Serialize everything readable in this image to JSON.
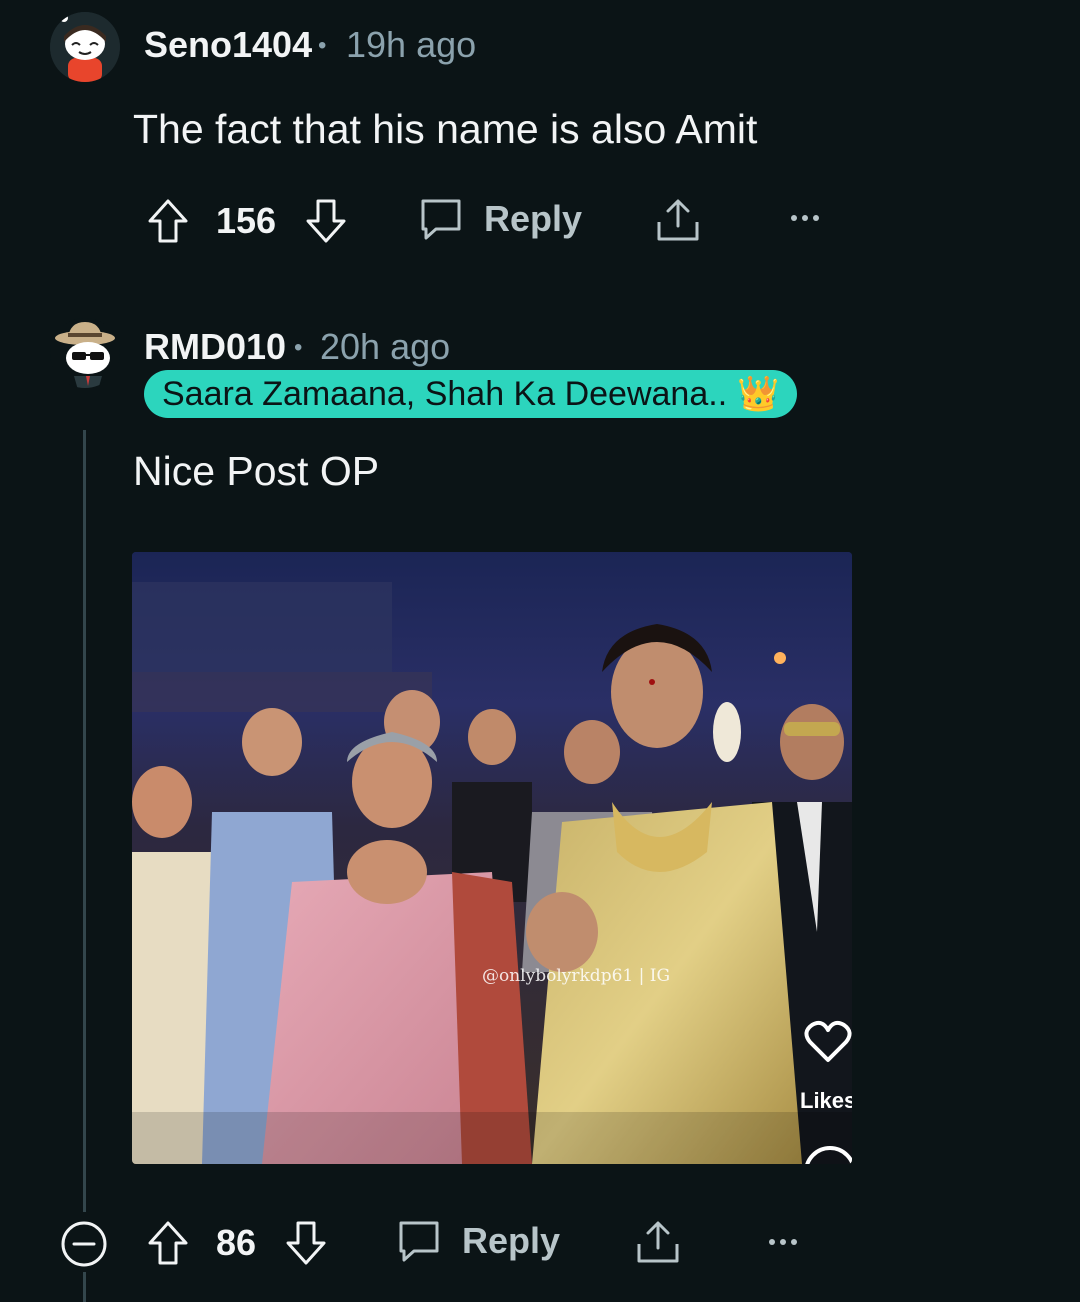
{
  "comments": [
    {
      "username": "Seno1404",
      "separator": "•",
      "time": "19h ago",
      "text": "The fact that his name is also Amit",
      "votes": "156",
      "reply_label": "Reply"
    },
    {
      "username": "RMD010",
      "separator": "•",
      "time": "20h ago",
      "flair": "Saara Zamaana, Shah Ka Deewana..",
      "flair_emoji": "👑",
      "text": "Nice Post OP",
      "media": {
        "watermark": "@onlybolyrkdp61 | IG",
        "likes_label": "Likes"
      },
      "votes": "86",
      "reply_label": "Reply"
    }
  ],
  "colors": {
    "background": "#0b1416",
    "flair_bg": "#2cd5bd",
    "muted_text": "#8ba2ad"
  },
  "icons": [
    "upvote-icon",
    "downvote-icon",
    "comment-icon",
    "share-icon",
    "more-icon",
    "collapse-icon"
  ]
}
